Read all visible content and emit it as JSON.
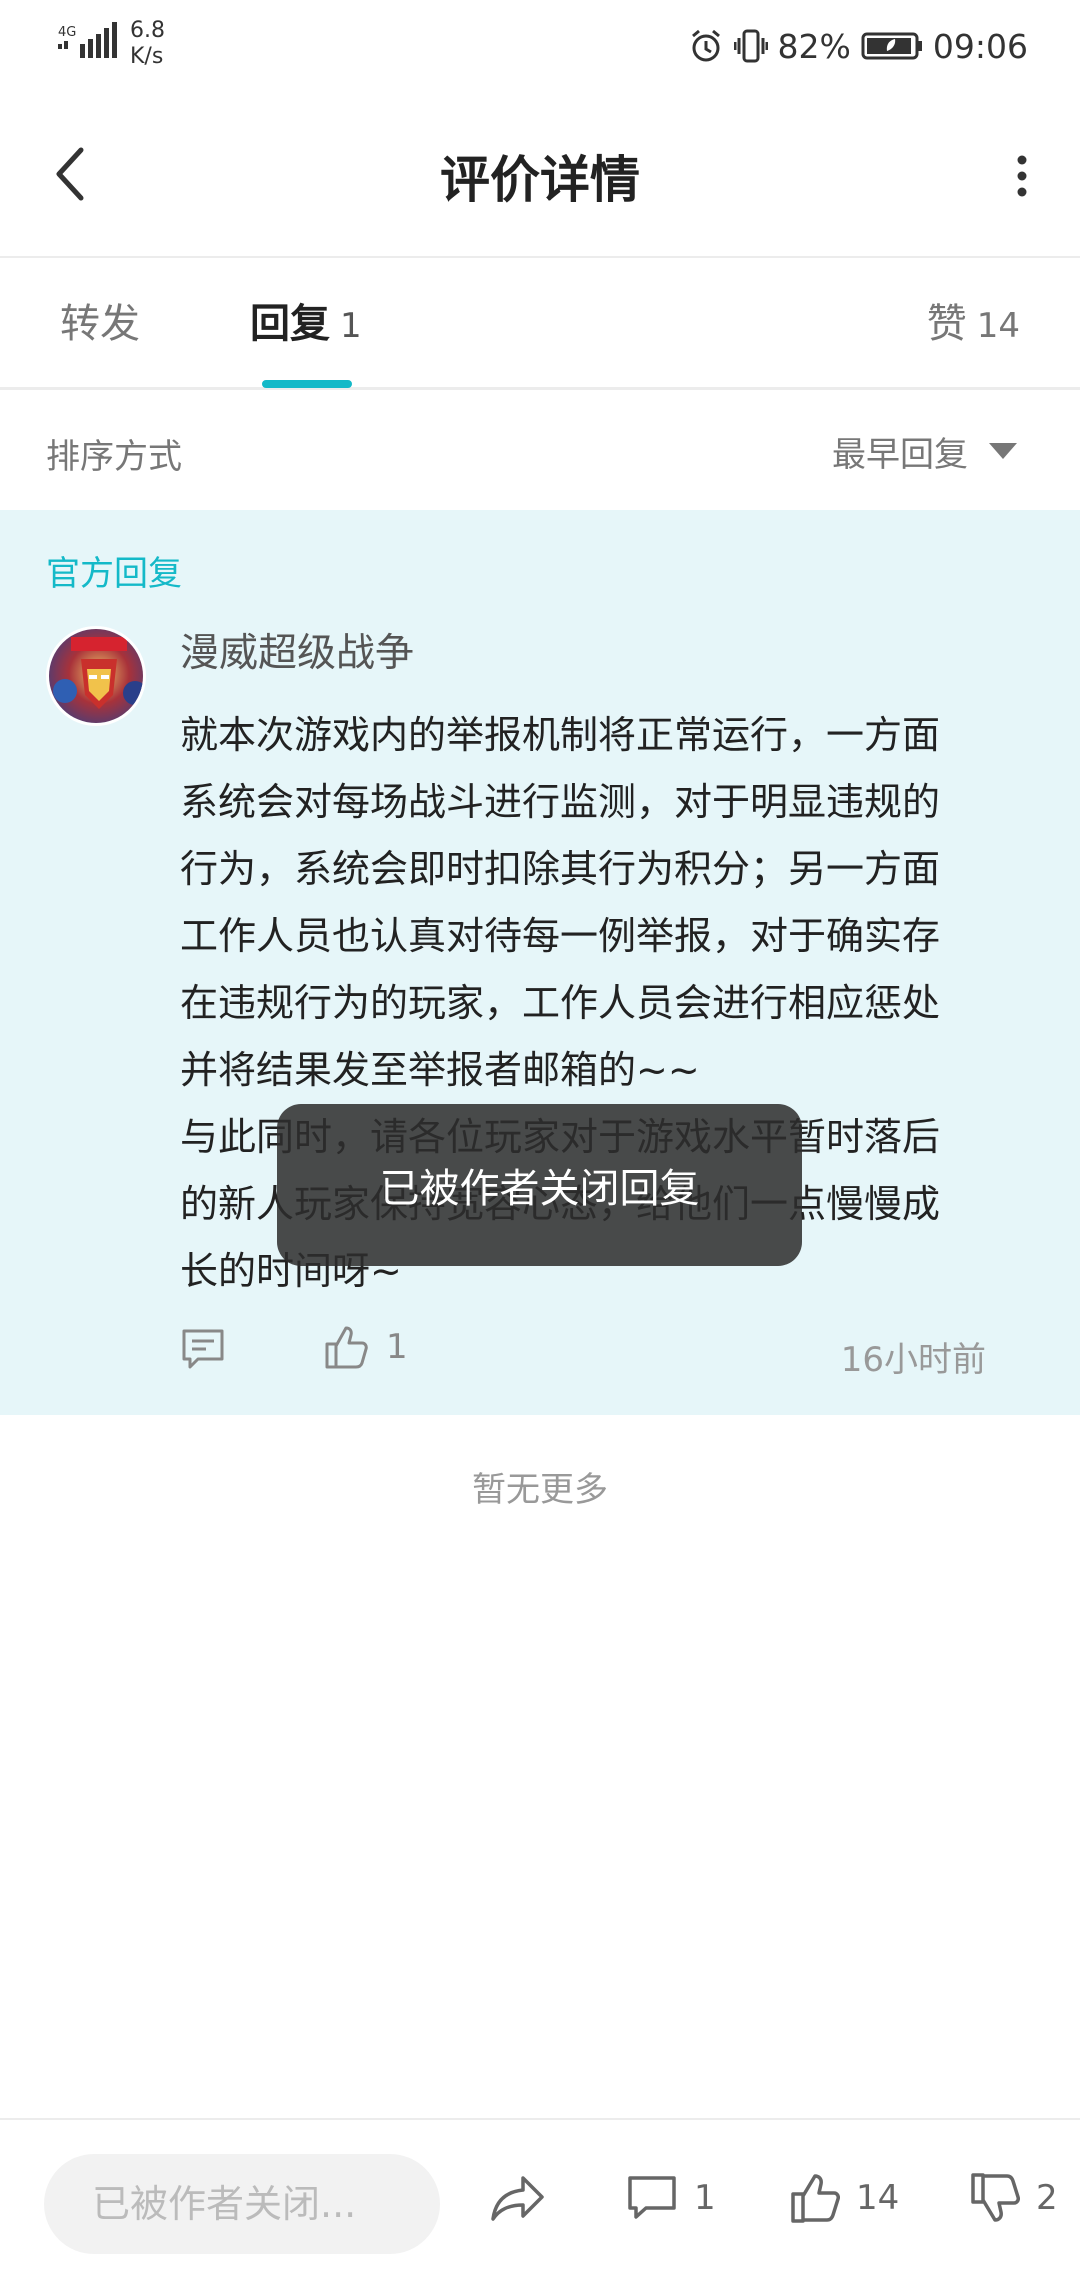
{
  "status_bar": {
    "network": "4G",
    "speed_value": "6.8",
    "speed_unit": "K/s",
    "battery": "82%",
    "time": "09:06"
  },
  "header": {
    "title": "评价详情",
    "back_icon": "chevron-left-icon",
    "more_icon": "more-vertical-icon"
  },
  "tabs": {
    "forward": {
      "label": "转发"
    },
    "reply": {
      "label": "回复",
      "count": "1"
    },
    "like": {
      "label": "赞",
      "count": "14"
    }
  },
  "sort": {
    "label": "排序方式",
    "selected": "最早回复"
  },
  "official_reply": {
    "section_label": "官方回复",
    "author": "漫威超级战争",
    "lines": [
      "就本次游戏内的举报机制将正常运行，一方面",
      "系统会对每场战斗进行监测，对于明显违规的",
      "行为，系统会即时扣除其行为积分；另一方面",
      "工作人员也认真对待每一例举报，对于确实存",
      "在违规行为的玩家，工作人员会进行相应惩处",
      "并将结果发至举报者邮箱的~~",
      "与此同时，请各位玩家对于游戏水平暂时落后",
      "的新人玩家保持宽容心态，给他们一点慢慢成",
      "长的时间呀~"
    ],
    "like_count": "1",
    "time": "16小时前"
  },
  "footer_text": "暂无更多",
  "toast": "已被作者关闭回复",
  "bottom_bar": {
    "input_placeholder": "已被作者关闭...",
    "comment_count": "1",
    "like_count": "14",
    "dislike_count": "2"
  },
  "colors": {
    "accent": "#14b9c8",
    "official_bg": "#e6f6f9"
  }
}
